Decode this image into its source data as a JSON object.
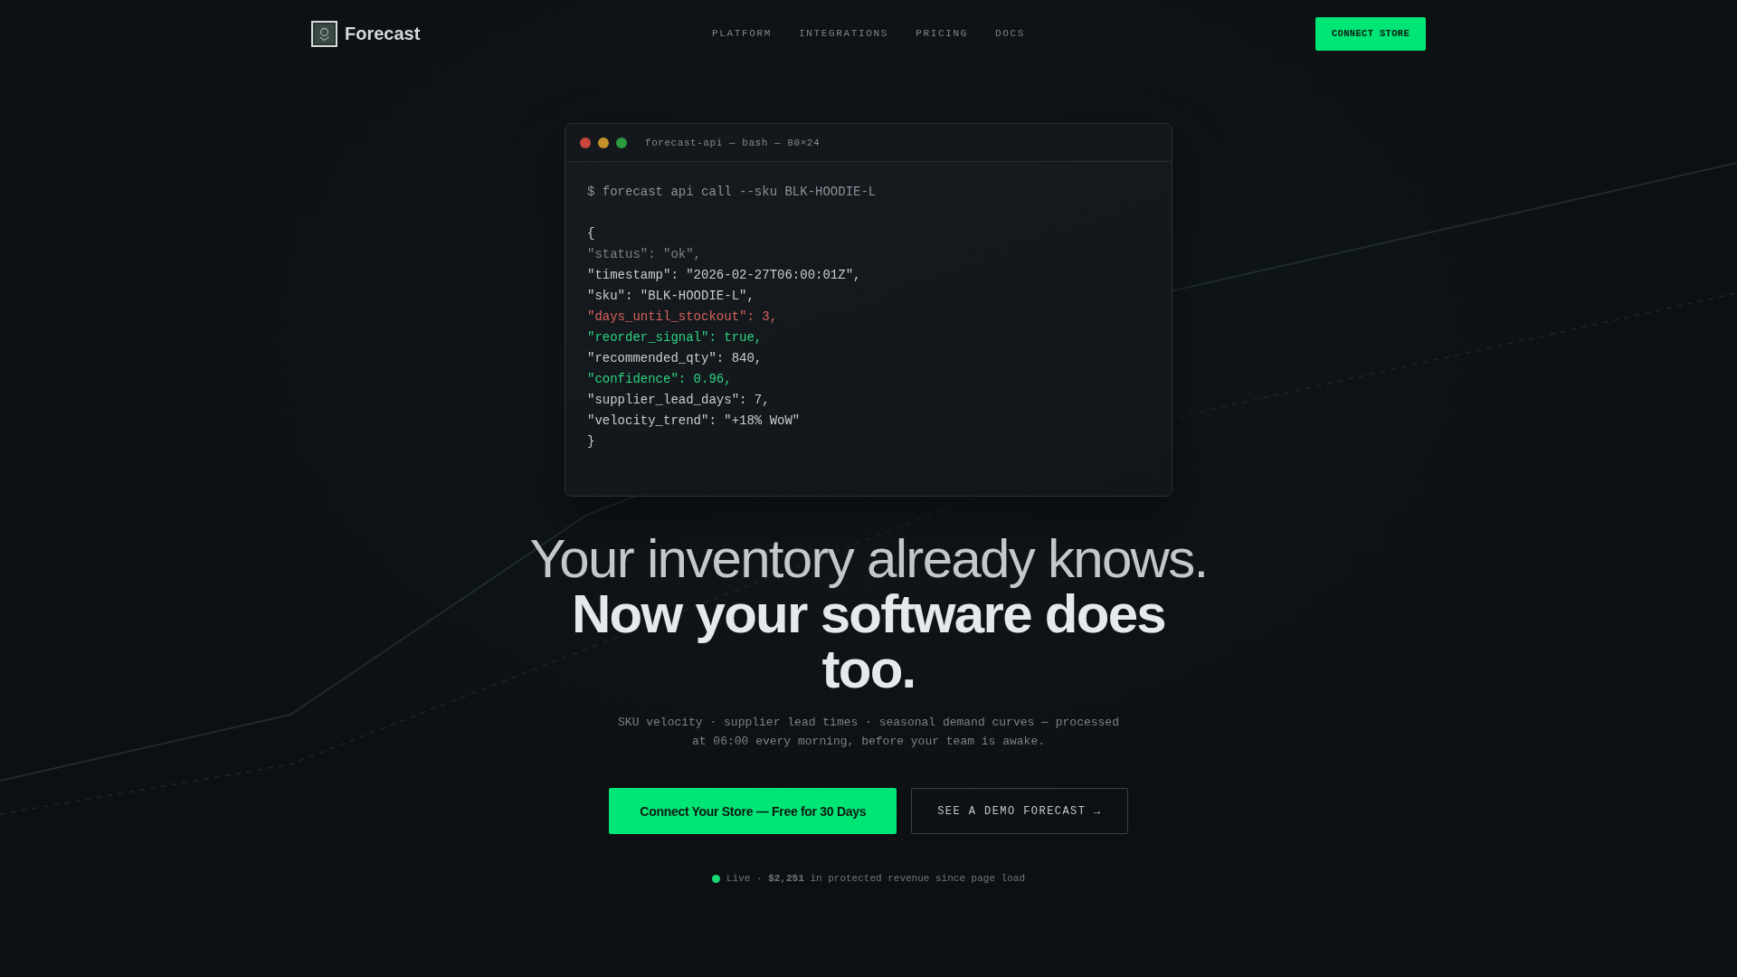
{
  "nav": {
    "brand": "Forecast",
    "links": [
      "PLATFORM",
      "INTEGRATIONS",
      "PRICING",
      "DOCS"
    ],
    "cta": "CONNECT STORE"
  },
  "terminal": {
    "title": "forecast-api — bash — 80×24",
    "command": "$ forecast api call --sku BLK-HOODIE-L",
    "output": [
      {
        "kind": "plain",
        "text": "{"
      },
      {
        "kind": "muted",
        "text": "\"status\": \"ok\","
      },
      {
        "kind": "plain",
        "text": "\"timestamp\": \"2026-02-27T06:00:01Z\","
      },
      {
        "kind": "plain",
        "text": "\"sku\": \"BLK-HOODIE-L\","
      },
      {
        "kind": "alert",
        "text": "\"days_until_stockout\": 3,"
      },
      {
        "kind": "success",
        "text": "\"reorder_signal\": true,"
      },
      {
        "kind": "plain",
        "text": "\"recommended_qty\": 840,"
      },
      {
        "kind": "success",
        "text": "\"confidence\": 0.96,"
      },
      {
        "kind": "plain",
        "text": "\"supplier_lead_days\": 7,"
      },
      {
        "kind": "plain",
        "text": "\"velocity_trend\": \"+18% WoW\""
      },
      {
        "kind": "plain",
        "text": "}"
      }
    ]
  },
  "hero": {
    "headline": "Your inventory already knows.",
    "headline_emphasis": "Now your software does too.",
    "subtitle": "SKU velocity · supplier lead times · seasonal demand curves — processed at 06:00 every morning, before your team is awake.",
    "primary_button": "Connect Your Store — Free for 30 Days",
    "secondary_button": "SEE A DEMO FORECAST →",
    "live_status": "Live · **$2,251** in protected revenue since page load"
  }
}
